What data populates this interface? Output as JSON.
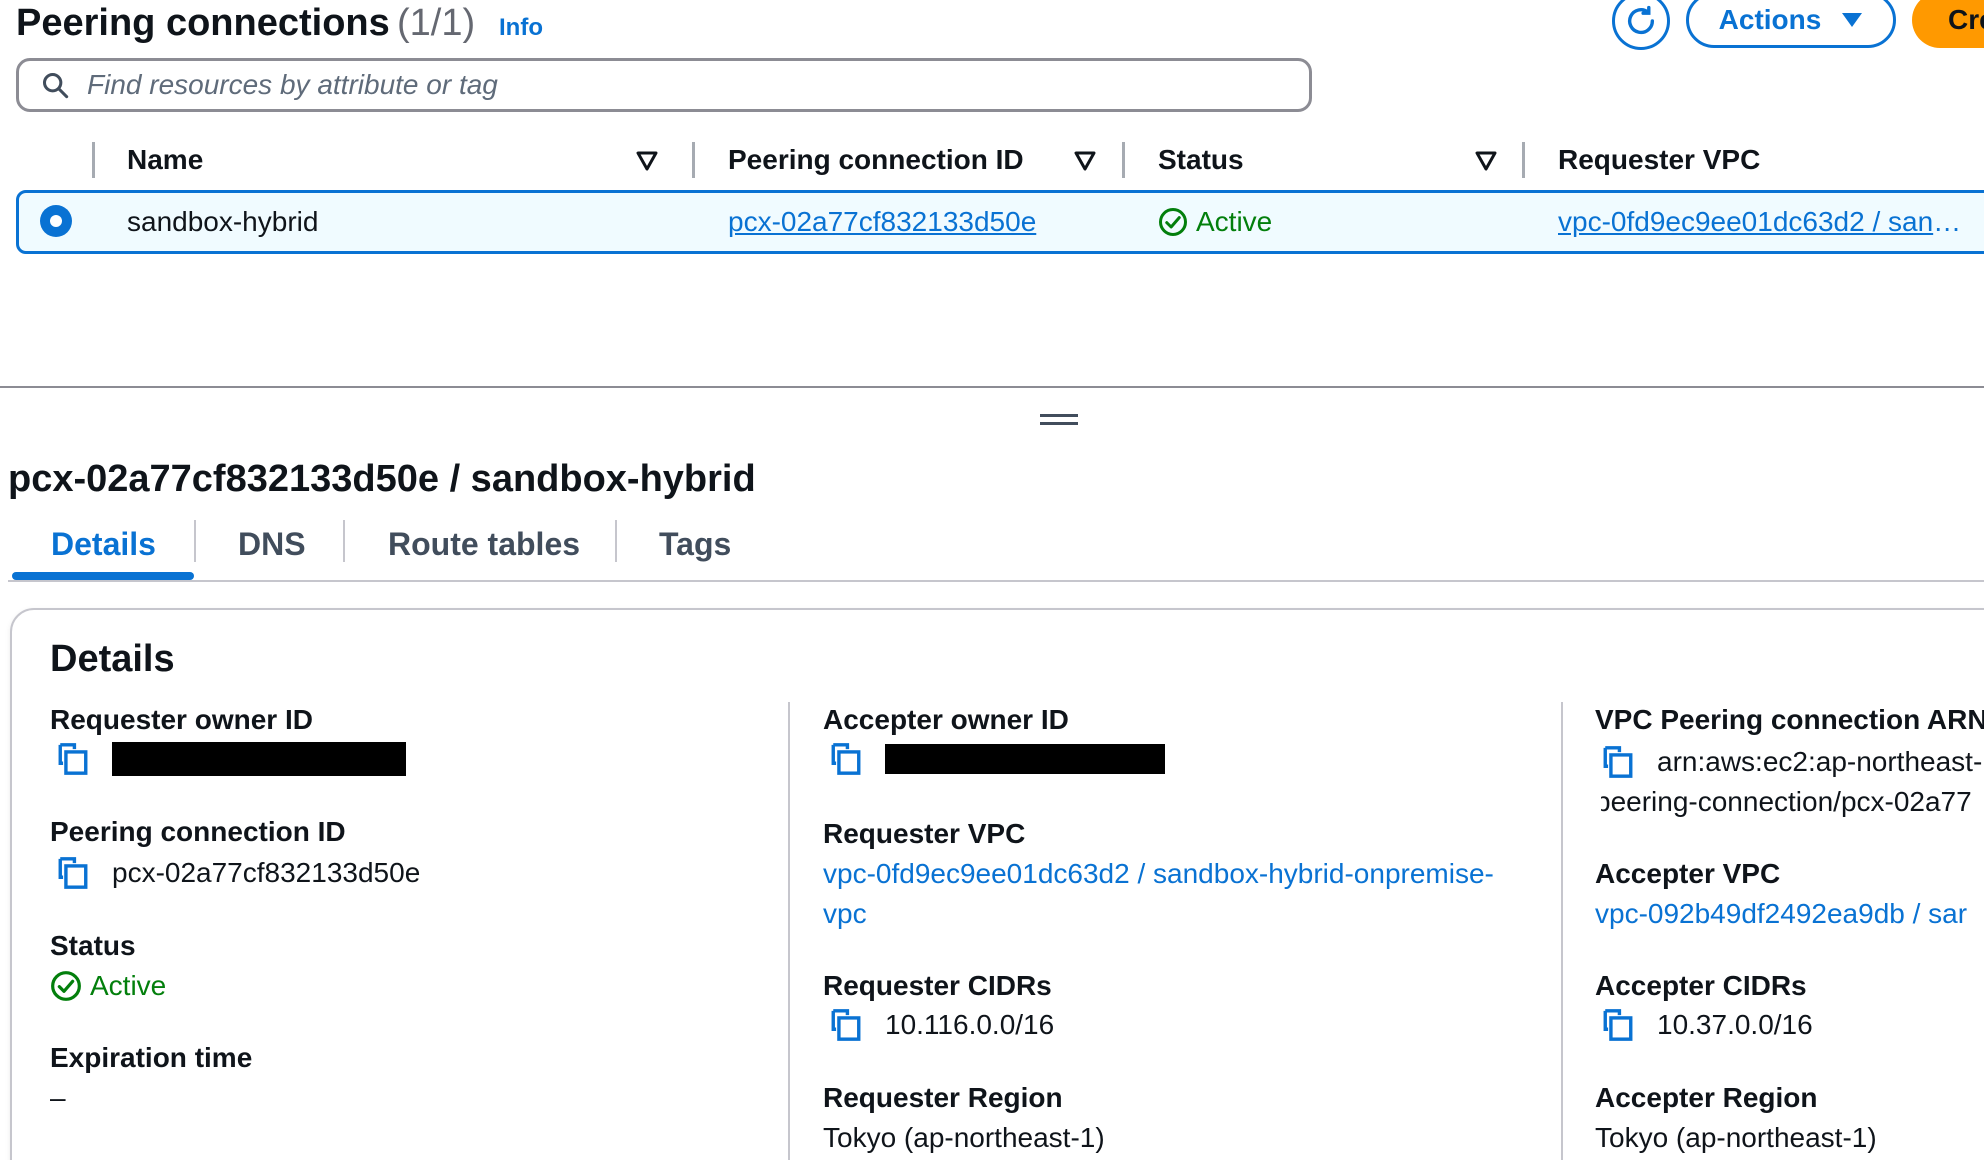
{
  "header": {
    "title": "Peering connections",
    "count": "(1/1)",
    "info": "Info",
    "actions_label": "Actions",
    "create_label": "Cre"
  },
  "search": {
    "placeholder": "Find resources by attribute or tag"
  },
  "table": {
    "columns": [
      "Name",
      "Peering connection ID",
      "Status",
      "Requester VPC"
    ],
    "rows": [
      {
        "name": "sandbox-hybrid",
        "peering_id": "pcx-02a77cf832133d50e",
        "status": "Active",
        "requester_vpc": "vpc-0fd9ec9ee01dc63d2 / sand…",
        "selected": true
      }
    ]
  },
  "detail": {
    "title": "pcx-02a77cf832133d50e / sandbox-hybrid",
    "tabs": [
      "Details",
      "DNS",
      "Route tables",
      "Tags"
    ],
    "active_tab": "Details",
    "panel_title": "Details",
    "col1": {
      "requester_owner_label": "Requester owner ID",
      "peering_id_label": "Peering connection ID",
      "peering_id_value": "pcx-02a77cf832133d50e",
      "status_label": "Status",
      "status_value": "Active",
      "expiration_label": "Expiration time",
      "expiration_value": "–"
    },
    "col2": {
      "accepter_owner_label": "Accepter owner ID",
      "requester_vpc_label": "Requester VPC",
      "requester_vpc_line1": "vpc-0fd9ec9ee01dc63d2 / sandbox-hybrid-onpremise-",
      "requester_vpc_line2": "vpc",
      "requester_cidrs_label": "Requester CIDRs",
      "requester_cidrs_value": "10.116.0.0/16",
      "requester_region_label": "Requester Region",
      "requester_region_value": "Tokyo (ap-northeast-1)"
    },
    "col3": {
      "arn_label": "VPC Peering connection ARN",
      "arn_line1": "arn:aws:ec2:ap-northeast-…",
      "arn_line2": "peering-connection/pcx-02a77",
      "accepter_vpc_label": "Accepter VPC",
      "accepter_vpc_value": "vpc-092b49df2492ea9db / sar",
      "accepter_cidrs_label": "Accepter CIDRs",
      "accepter_cidrs_value": "10.37.0.0/16",
      "accepter_region_label": "Accepter Region",
      "accepter_region_value": "Tokyo (ap-northeast-1)"
    }
  },
  "colors": {
    "accent": "#0972d3",
    "success": "#037f0c",
    "primary_button": "#ff9900"
  },
  "icons": [
    "refresh-icon",
    "caret-down-icon",
    "search-icon",
    "sort-icon",
    "check-circle-icon",
    "copy-icon",
    "drag-handle-icon"
  ]
}
